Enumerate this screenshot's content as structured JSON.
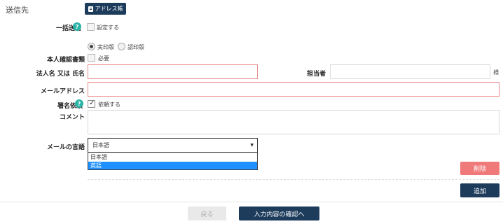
{
  "section": {
    "title": "送信先",
    "address_book_button": "アドレス帳"
  },
  "bulk_send": {
    "label": "一括送信",
    "checkbox_label": "設定する",
    "checked": false
  },
  "identity_check": {
    "radio_options": [
      "実印版",
      "認印版"
    ],
    "selected": "実印版",
    "label": "本人確認書類",
    "checkbox_label": "必要",
    "checked": false
  },
  "recipient": {
    "name_label": "法人名 又は 氏名",
    "name_value": "",
    "person_label": "担当者",
    "person_value": "",
    "honorific": "様"
  },
  "email": {
    "label": "メールアドレス",
    "value": ""
  },
  "signature_request": {
    "label": "署名依頼",
    "checkbox_label": "依頼する",
    "checked": true
  },
  "comment": {
    "label": "コメント",
    "value": ""
  },
  "mail_language": {
    "label": "メールの言語",
    "selected": "日本語",
    "options": [
      "日本語",
      "英語"
    ],
    "highlighted": "英語"
  },
  "actions": {
    "delete": "削除",
    "add": "追加"
  },
  "footer": {
    "back": "戻る",
    "confirm": "入力内容の確認へ"
  },
  "colors": {
    "primary": "#1d3c5c",
    "help": "#2bb3a5",
    "danger": "#f07a7a",
    "error_border": "#e88a8a",
    "highlight": "#1e90ff"
  }
}
